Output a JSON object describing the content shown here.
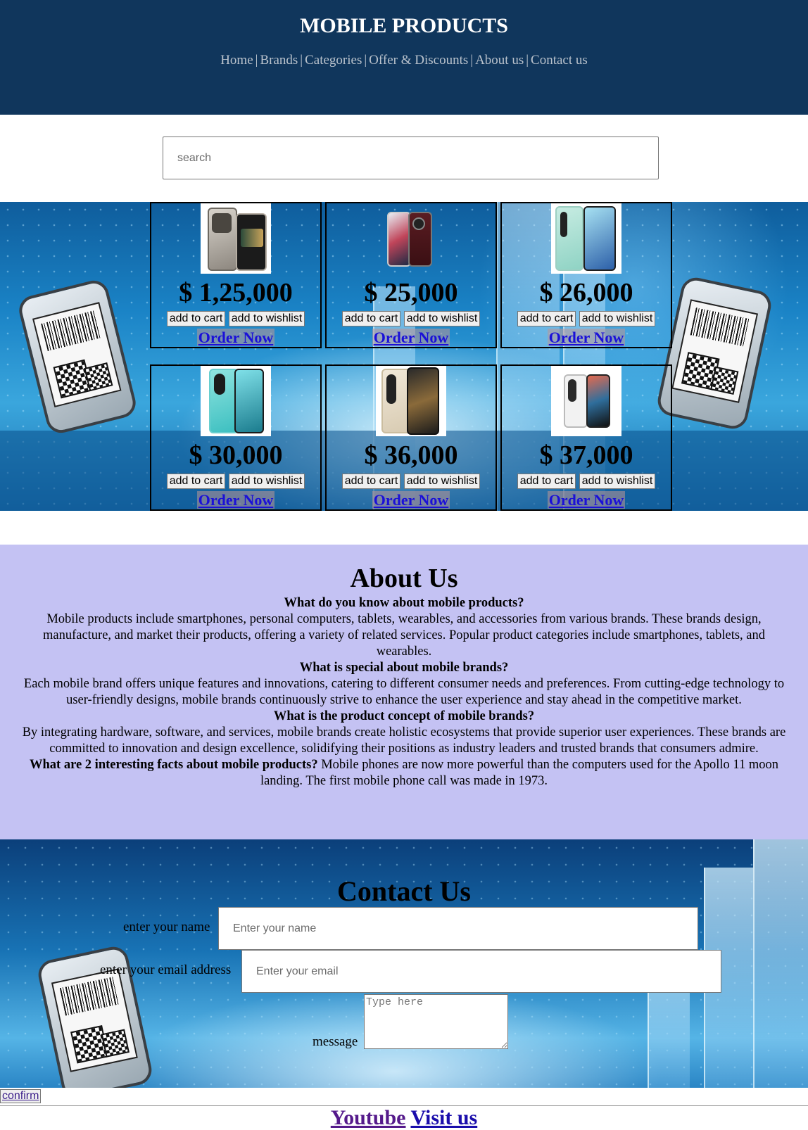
{
  "header": {
    "title": "MOBILE PRODUCTS",
    "nav": [
      "Home",
      "Brands",
      "Categories",
      "Offer & Discounts",
      "About us",
      "Contact us"
    ],
    "separator": "|"
  },
  "search": {
    "placeholder": "search"
  },
  "products": [
    {
      "price": "$ 1,25,000",
      "add_to_cart": "add to cart",
      "add_to_wishlist": "add to wishlist",
      "order": "Order Now"
    },
    {
      "price": "$ 25,000",
      "add_to_cart": "add to cart",
      "add_to_wishlist": "add to wishlist",
      "order": "Order Now"
    },
    {
      "price": "$ 26,000",
      "add_to_cart": "add to cart",
      "add_to_wishlist": "add to wishlist",
      "order": "Order Now"
    },
    {
      "price": "$ 30,000",
      "add_to_cart": "add to cart",
      "add_to_wishlist": "add to wishlist",
      "order": "Order Now"
    },
    {
      "price": "$ 36,000",
      "add_to_cart": "add to cart",
      "add_to_wishlist": "add to wishlist",
      "order": "Order Now"
    },
    {
      "price": "$ 37,000",
      "add_to_cart": "add to cart",
      "add_to_wishlist": "add to wishlist",
      "order": "Order Now"
    }
  ],
  "about": {
    "title": "About Us",
    "q1": "What do you know about mobile products?",
    "a1": "Mobile products include smartphones, personal computers, tablets, wearables, and accessories from various brands. These brands design, manufacture, and market their products, offering a variety of related services. Popular product categories include smartphones, tablets, and wearables.",
    "q2": "What is special about mobile brands?",
    "a2": "Each mobile brand offers unique features and innovations, catering to different consumer needs and preferences. From cutting-edge technology to user-friendly designs, mobile brands continuously strive to enhance the user experience and stay ahead in the competitive market.",
    "q3": "What is the product concept of mobile brands?",
    "a3": "By integrating hardware, software, and services, mobile brands create holistic ecosystems that provide superior user experiences. These brands are committed to innovation and design excellence, solidifying their positions as industry leaders and trusted brands that consumers admire.",
    "q4": "What are 2 interesting facts about mobile products?",
    "a4": "Mobile phones are now more powerful than the computers used for the Apollo 11 moon landing. The first mobile phone call was made in 1973."
  },
  "contact": {
    "title": "Contact Us",
    "name_label": "enter your name",
    "name_placeholder": "Enter your name",
    "email_label": "enter your email address",
    "email_placeholder": "Enter your email",
    "message_label": "message",
    "message_placeholder": "Type here",
    "confirm": "confirm"
  },
  "footer": {
    "youtube": "Youtube",
    "visit": "Visit us"
  },
  "colors": {
    "header_bg": "#10365c",
    "about_bg": "#c4c2f3",
    "link": "#1a10d8",
    "visited": "#551a8b"
  }
}
